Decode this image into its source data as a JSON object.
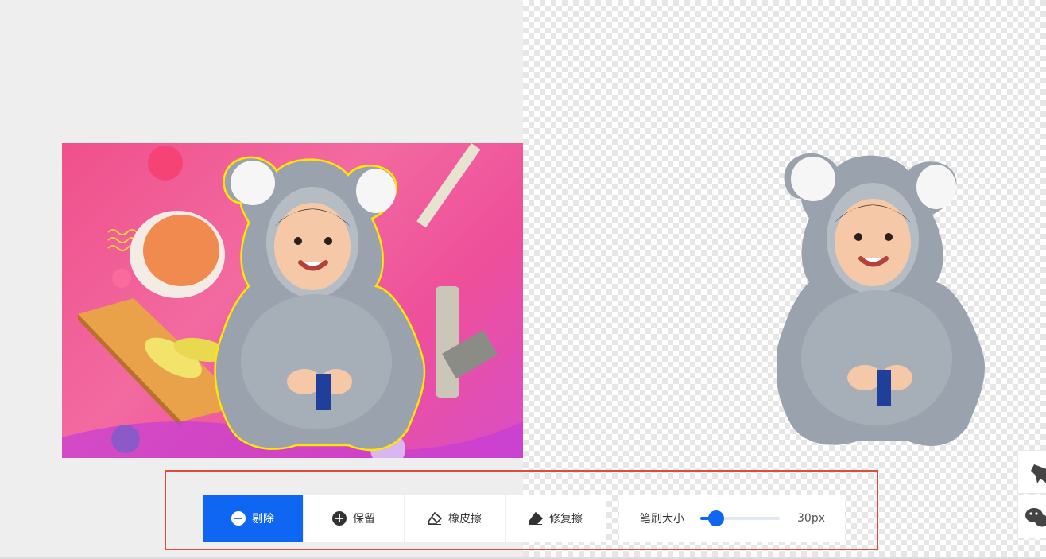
{
  "toolbar": {
    "remove_label": "剔除",
    "keep_label": "保留",
    "eraser_label": "橡皮擦",
    "restore_label": "修复擦"
  },
  "brush": {
    "label": "笔刷大小",
    "value_text": "30px",
    "level_fraction": 0.2
  },
  "icons": {
    "remove": "minus-circle-icon",
    "keep": "plus-circle-icon",
    "eraser": "eraser-icon",
    "restore": "eraser-icon",
    "side_top": "bird-logo-icon",
    "side_bottom": "wechat-icon"
  },
  "colors": {
    "accent": "#0f66f2",
    "highlight_frame": "#e04b3c",
    "selection_outline": "#ffe600"
  }
}
